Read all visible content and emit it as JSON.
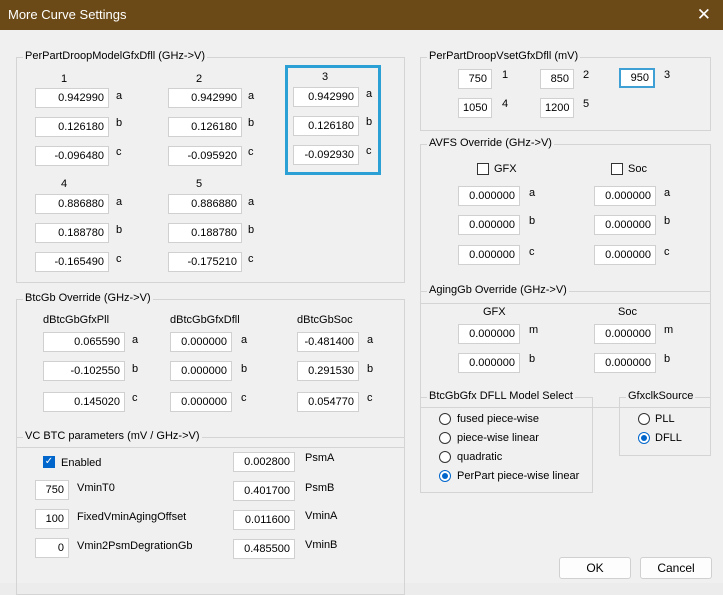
{
  "window": {
    "title": "More Curve Settings",
    "close_glyph": "✕"
  },
  "droop_model": {
    "label": "PerPartDroopModelGfxDfll (GHz->V)",
    "col1": {
      "header": "1",
      "a": "0.942990",
      "b": "0.126180",
      "c": "-0.096480"
    },
    "col2": {
      "header": "2",
      "a": "0.942990",
      "b": "0.126180",
      "c": "-0.095920"
    },
    "col3": {
      "header": "3",
      "a": "0.942990",
      "b": "0.126180",
      "c": "-0.092930"
    },
    "col4": {
      "header": "4",
      "a": "0.886880",
      "b": "0.188780",
      "c": "-0.165490"
    },
    "col5": {
      "header": "5",
      "a": "0.886880",
      "b": "0.188780",
      "c": "-0.175210"
    },
    "suffix": {
      "a": "a",
      "b": "b",
      "c": "c"
    }
  },
  "btcgb": {
    "label": "BtcGb Override (GHz->V)",
    "col1": {
      "header": "dBtcGbGfxPll",
      "a": "0.065590",
      "b": "-0.102550",
      "c": "0.145020"
    },
    "col2": {
      "header": "dBtcGbGfxDfll",
      "a": "0.000000",
      "b": "0.000000",
      "c": "0.000000"
    },
    "col3": {
      "header": "dBtcGbSoc",
      "a": "-0.481400",
      "b": "0.291530",
      "c": "0.054770"
    }
  },
  "vc_btc": {
    "label": "VC BTC parameters (mV / GHz->V)",
    "enabled_label": "Enabled",
    "vmin_t0": {
      "value": "750",
      "label": "VminT0"
    },
    "aging_offset": {
      "value": "100",
      "label": "FixedVminAgingOffset"
    },
    "psm_degration": {
      "value": "0",
      "label": "Vmin2PsmDegrationGb"
    },
    "psm_a": {
      "value": "0.002800",
      "label": "PsmA"
    },
    "psm_b": {
      "value": "0.401700",
      "label": "PsmB"
    },
    "vmin_a": {
      "value": "0.011600",
      "label": "VminA"
    },
    "vmin_b": {
      "value": "0.485500",
      "label": "VminB"
    }
  },
  "vset": {
    "label": "PerPartDroopVsetGfxDfll (mV)",
    "items": [
      {
        "value": "750",
        "label": "1"
      },
      {
        "value": "850",
        "label": "2"
      },
      {
        "value": "950",
        "label": "3"
      },
      {
        "value": "1050",
        "label": "4"
      },
      {
        "value": "1200",
        "label": "5"
      }
    ]
  },
  "avfs": {
    "label": "AVFS Override (GHz->V)",
    "gfx_label": "GFX",
    "soc_label": "Soc",
    "gfx": {
      "a": "0.000000",
      "b": "0.000000",
      "c": "0.000000"
    },
    "soc": {
      "a": "0.000000",
      "b": "0.000000",
      "c": "0.000000"
    }
  },
  "aginggb": {
    "label": "AgingGb Override (GHz->V)",
    "gfx_header": "GFX",
    "soc_header": "Soc",
    "gfx": {
      "m": "0.000000",
      "b": "0.000000"
    },
    "soc": {
      "m": "0.000000",
      "b": "0.000000"
    },
    "suffix": {
      "m": "m",
      "b": "b"
    }
  },
  "dfll_model": {
    "label": "BtcGbGfx DFLL Model Select",
    "options": [
      "fused piece-wise",
      "piece-wise linear",
      "quadratic",
      "PerPart piece-wise linear"
    ],
    "selected": "PerPart piece-wise linear"
  },
  "gfxclk": {
    "label": "GfxclkSource",
    "options": [
      "PLL",
      "DFLL"
    ],
    "selected": "DFLL"
  },
  "buttons": {
    "ok": "OK",
    "cancel": "Cancel"
  },
  "colors": {
    "titlebar": "#6b4a17",
    "accent": "#0066cc",
    "highlight": "#2aa0d4"
  },
  "checkbox_glyph": "✓"
}
